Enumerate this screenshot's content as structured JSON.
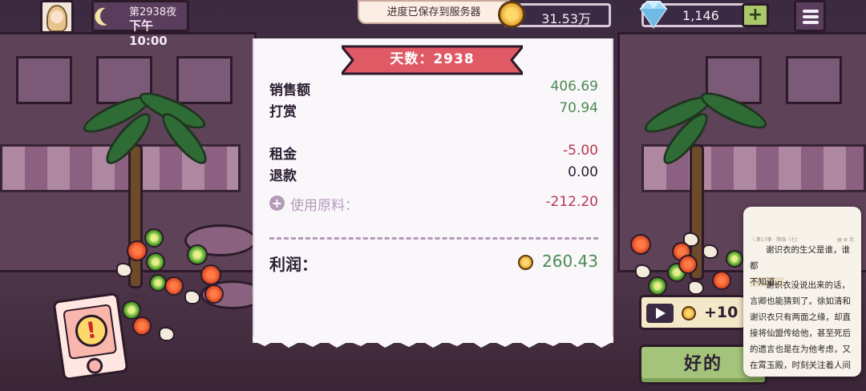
{
  "hud": {
    "night": "第2938夜",
    "time": "下午10:00",
    "coins": "31.53万",
    "gems": "1,146",
    "gem_add": "+"
  },
  "toast": "进度已保存到服务器",
  "receipt": {
    "title": "天数：2938",
    "sales_label": "销售额",
    "sales_value": "406.69",
    "tips_label": "打赏",
    "tips_value": "70.94",
    "rent_label": "租金",
    "rent_value": "-5.00",
    "refund_label": "退款",
    "refund_value": "0.00",
    "materials_label": "使用原料：",
    "materials_value": "-212.20",
    "profit_label": "利润：",
    "profit_value": "260.43"
  },
  "ad_reward": "+10",
  "ok_button": "好的",
  "reader": {
    "header_left": "〈 第17章 · 降临（七）",
    "header_right": "▤ ⚙ 北",
    "p1a": "谢识衣的生父是谁，谁都",
    "p1b": "不知道。",
    "p2": "谢识衣没说出来的话，言卿也能猜到了。徐如清和谢识衣只有两面之缘，却直接将仙盟传给他，甚至死后的遗言也是在为他考虑，又在霄玉殿，时刻关注着人间一个微不足道的少年。"
  },
  "colors": {
    "positive": "#4a8a52",
    "negative": "#b2384e",
    "ribbon": "#e05a66",
    "ok_button": "#a3c47a"
  },
  "icons": [
    "moon-icon",
    "coin-icon",
    "diamond-icon",
    "plus-icon",
    "menu-icon",
    "alert-icon",
    "play-icon"
  ]
}
